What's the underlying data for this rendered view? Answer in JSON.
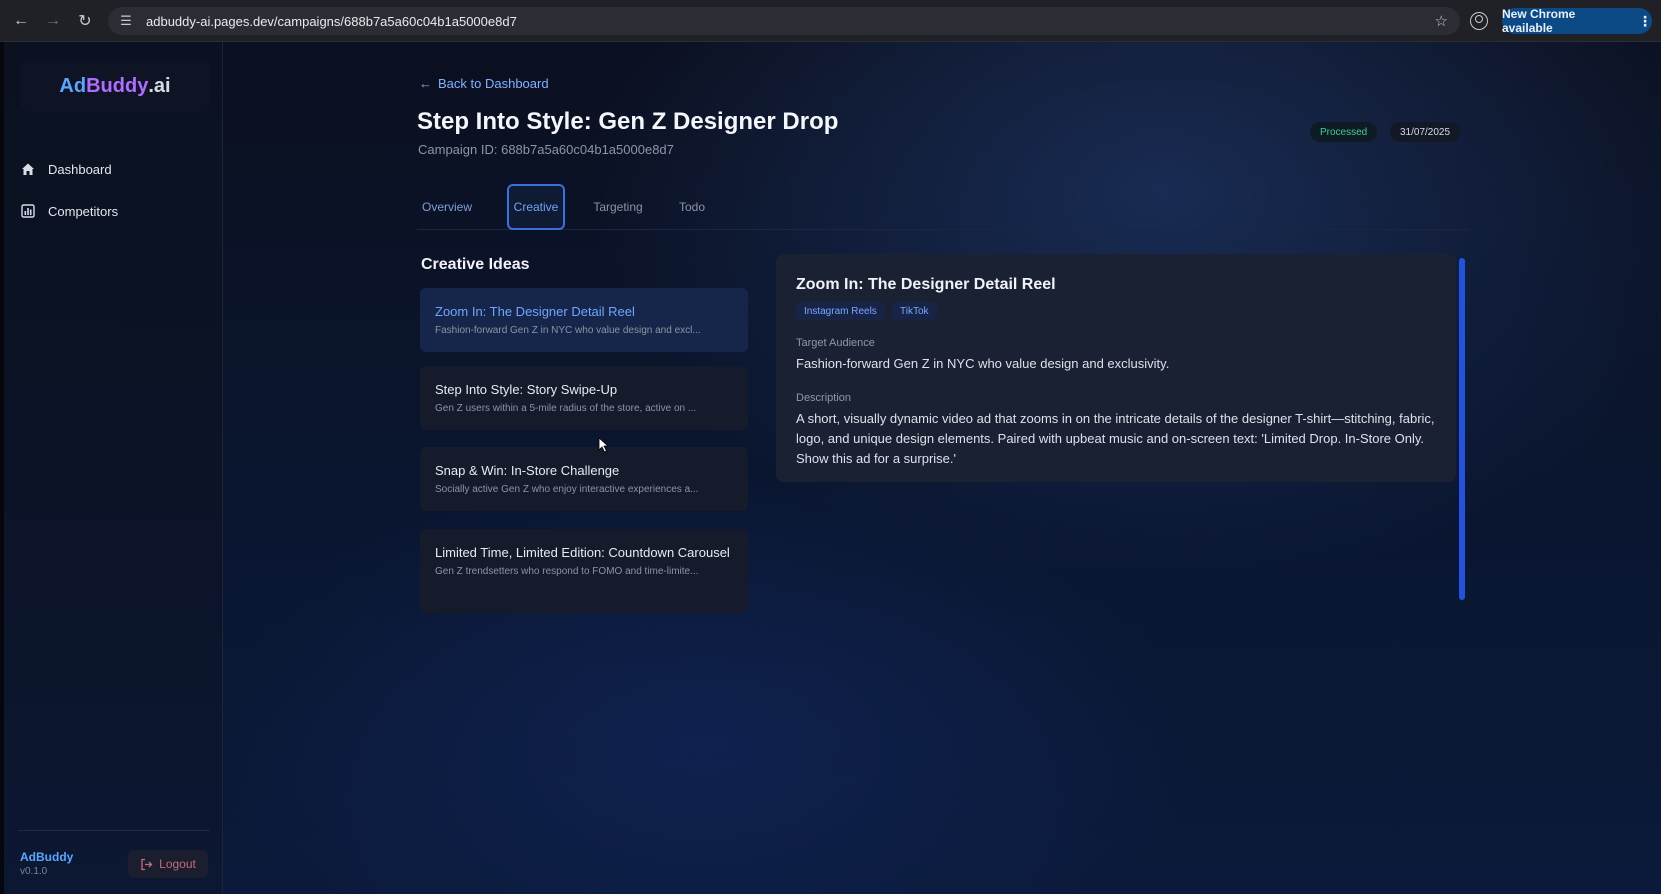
{
  "browser": {
    "url": "adbuddy-ai.pages.dev/campaigns/688b7a5a60c04b1a5000e8d7",
    "update_label": "New Chrome available"
  },
  "sidebar": {
    "logo": {
      "ad": "Ad",
      "buddy": "Buddy",
      "ai": ".ai"
    },
    "items": [
      {
        "label": "Dashboard",
        "icon": "home-icon"
      },
      {
        "label": "Competitors",
        "icon": "chart-icon"
      }
    ],
    "brand": "AdBuddy",
    "version": "v0.1.0",
    "logout_label": "Logout"
  },
  "header": {
    "back_label": "Back to Dashboard",
    "title": "Step Into Style: Gen Z Designer Drop",
    "campaign_id": "Campaign ID: 688b7a5a60c04b1a5000e8d7",
    "status": "Processed",
    "date": "31/07/2025"
  },
  "tabs": [
    "Overview",
    "Creative",
    "Targeting",
    "Todo"
  ],
  "active_tab": "Creative",
  "creative": {
    "section_title": "Creative Ideas",
    "ideas": [
      {
        "title": "Zoom In: The Designer Detail Reel",
        "subtitle": "Fashion-forward Gen Z in NYC who value design and excl..."
      },
      {
        "title": "Step Into Style: Story Swipe-Up",
        "subtitle": "Gen Z users within a 5-mile radius of the store, active on ..."
      },
      {
        "title": "Snap & Win: In-Store Challenge",
        "subtitle": "Socially active Gen Z who enjoy interactive experiences a..."
      },
      {
        "title": "Limited Time, Limited Edition: Countdown Carousel",
        "subtitle": "Gen Z trendsetters who respond to FOMO and time-limite..."
      }
    ],
    "detail": {
      "title": "Zoom In: The Designer Detail Reel",
      "platforms": [
        "Instagram Reels",
        "TikTok"
      ],
      "audience_label": "Target Audience",
      "audience": "Fashion-forward Gen Z in NYC who value design and exclusivity.",
      "description_label": "Description",
      "description": "A short, visually dynamic video ad that zooms in on the intricate details of the designer T-shirt—stitching, fabric, logo, and unique design elements. Paired with upbeat music and on-screen text: 'Limited Drop. In-Store Only. Show this ad for a surprise.'"
    }
  },
  "colors": {
    "accent": "#3b6fe0",
    "link": "#7fb2ff",
    "status_green": "#3ad18e",
    "logout_red": "#c66a7a"
  }
}
